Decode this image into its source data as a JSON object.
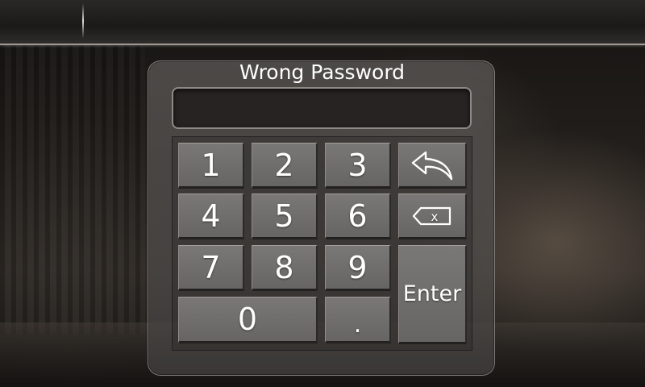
{
  "dialog": {
    "title": "Wrong Password",
    "password_value": ""
  },
  "keypad": {
    "keys": {
      "k1": "1",
      "k2": "2",
      "k3": "3",
      "k4": "4",
      "k5": "5",
      "k6": "6",
      "k7": "7",
      "k8": "8",
      "k9": "9",
      "k0": "0",
      "dot": ".",
      "enter": "Enter"
    },
    "icons": {
      "back": "back-arrow-icon",
      "clear": "backspace-icon",
      "clear_glyph": "x"
    }
  },
  "colors": {
    "key_face": "#6f6d6b",
    "text": "#ffffff",
    "display_bg": "#262322"
  }
}
